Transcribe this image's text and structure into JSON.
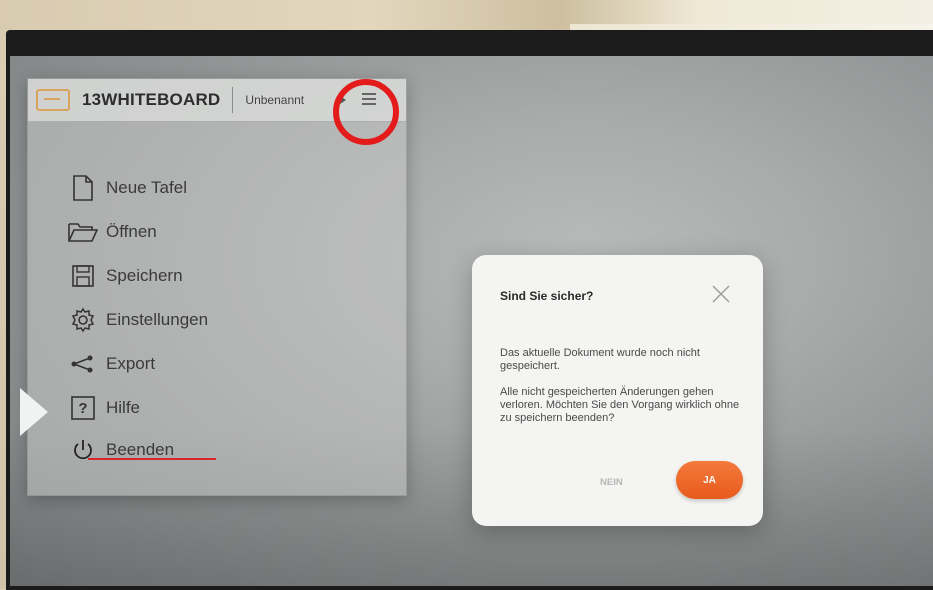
{
  "app": {
    "brand": "13WHITEBOARD",
    "document_name": "Unbenannt"
  },
  "menu": {
    "items": [
      {
        "label": "Neue Tafel",
        "icon": "new-document-icon"
      },
      {
        "label": "Öffnen",
        "icon": "folder-open-icon"
      },
      {
        "label": "Speichern",
        "icon": "floppy-disk-icon"
      },
      {
        "label": "Einstellungen",
        "icon": "gear-icon"
      },
      {
        "label": "Export",
        "icon": "share-icon"
      },
      {
        "label": "Hilfe",
        "icon": "help-icon"
      },
      {
        "label": "Beenden",
        "icon": "power-icon"
      }
    ]
  },
  "dialog": {
    "title": "Sind Sie sicher?",
    "message1": "Das aktuelle Dokument wurde noch nicht gespeichert.",
    "message2": "Alle nicht gespeicherten Änderungen gehen verloren. Möchten Sie den Vorgang wirklich ohne zu speichern beenden?",
    "no_label": "NEIN",
    "yes_label": "JA"
  },
  "colors": {
    "accent_orange": "#ee6a2b",
    "annotation_red": "#e31b1b"
  }
}
